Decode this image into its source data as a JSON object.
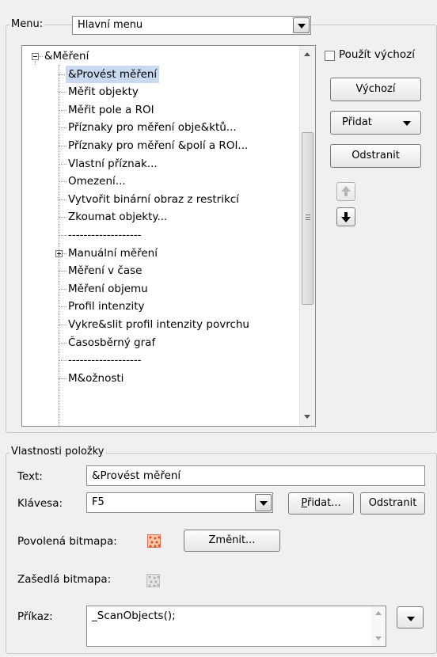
{
  "menu": {
    "label": "Menu:",
    "selected": "Hlavní menu"
  },
  "tree": {
    "items": [
      {
        "label": "&Měření",
        "level": 0,
        "expander": "minus"
      },
      {
        "label": "&Provést měření",
        "level": 1,
        "selected": true
      },
      {
        "label": "Měřit objekty",
        "level": 1
      },
      {
        "label": "Měřit pole a ROI",
        "level": 1
      },
      {
        "label": "Příznaky pro měření obje&ktů...",
        "level": 1
      },
      {
        "label": "Příznaky pro měření &polí a ROI...",
        "level": 1
      },
      {
        "label": "Vlastní příznak...",
        "level": 1
      },
      {
        "label": "Omezení...",
        "level": 1
      },
      {
        "label": "Vytvořit binární obraz z restrikcí",
        "level": 1
      },
      {
        "label": "Zkoumat objekty...",
        "level": 1
      },
      {
        "label": "-------------------",
        "level": 1
      },
      {
        "label": "Manuální měření",
        "level": 1,
        "expander": "plus"
      },
      {
        "label": "Měření v čase",
        "level": 1
      },
      {
        "label": "Měření objemu",
        "level": 1
      },
      {
        "label": "Profil intenzity",
        "level": 1
      },
      {
        "label": "Vykre&slit profil intenzity povrchu",
        "level": 1
      },
      {
        "label": "Časosběrný graf",
        "level": 1
      },
      {
        "label": "-------------------",
        "level": 1
      },
      {
        "label": "M&ožnosti",
        "level": 1
      }
    ]
  },
  "right_panel": {
    "use_default_label": "Použít výchozí",
    "default_button": "Výchozí",
    "add_button": "Přidat",
    "remove_button": "Odstranit"
  },
  "properties": {
    "title": "Vlastnosti položky",
    "text_label": "Text:",
    "text_value": "&Provést měření",
    "key_label": "Klávesa:",
    "key_value": "F5",
    "key_add_button_first": "P",
    "key_add_button_rest": "řidat...",
    "key_remove_button": "Odstranit",
    "enabled_bitmap_label": "Povolená bitmapa:",
    "change_button": "Změnit...",
    "disabled_bitmap_label": "Zašedlá bitmapa:",
    "command_label": "Příkaz:",
    "command_value": "_ScanObjects();"
  }
}
